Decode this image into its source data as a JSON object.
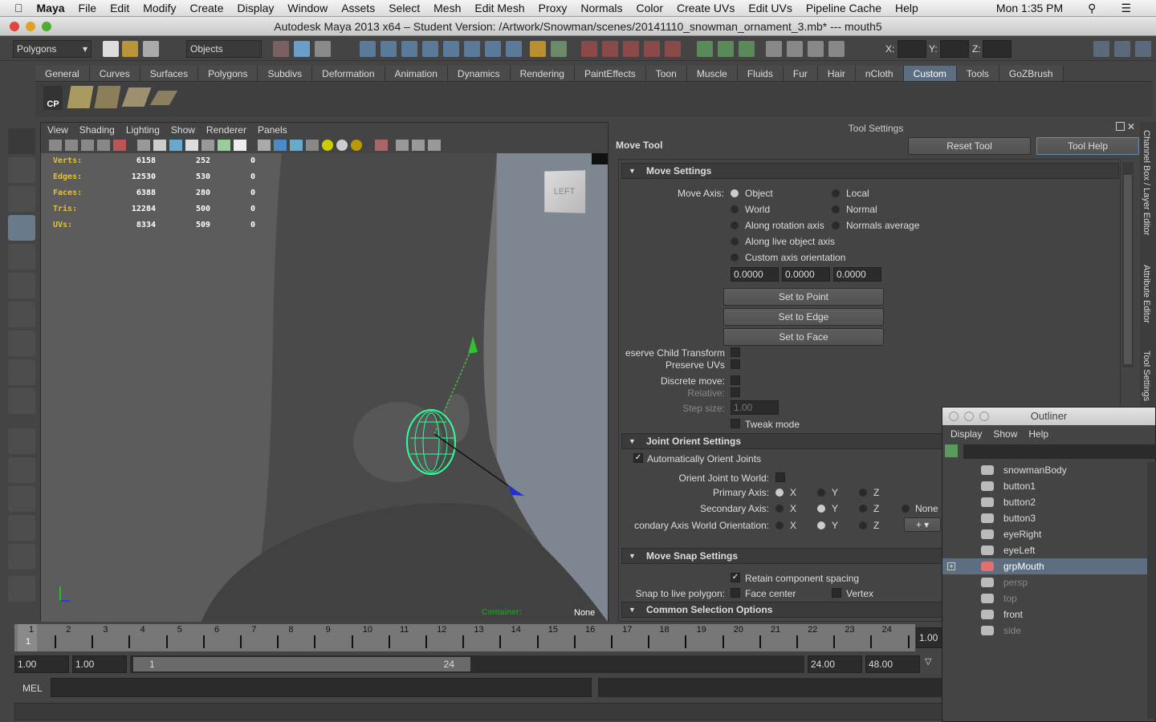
{
  "mac_menu": {
    "apple": "",
    "items": [
      "Maya",
      "File",
      "Edit",
      "Modify",
      "Create",
      "Display",
      "Window",
      "Assets",
      "Select",
      "Mesh",
      "Edit Mesh",
      "Proxy",
      "Normals",
      "Color",
      "Create UVs",
      "Edit UVs",
      "Pipeline Cache",
      "Help"
    ],
    "clock": "Mon 1:35 PM"
  },
  "window": {
    "title": "Autodesk Maya 2013 x64 – Student Version: /Artwork/Snowman/scenes/20141110_snowman_ornament_3.mb*  ---   mouth5"
  },
  "toolbar": {
    "menu_set": "Polygons",
    "selection_mode": "Objects",
    "x_label": "X:",
    "y_label": "Y:",
    "z_label": "Z:"
  },
  "shelf": {
    "tabs": [
      "General",
      "Curves",
      "Surfaces",
      "Polygons",
      "Subdivs",
      "Deformation",
      "Animation",
      "Dynamics",
      "Rendering",
      "PaintEffects",
      "Toon",
      "Muscle",
      "Fluids",
      "Fur",
      "Hair",
      "nCloth",
      "Custom",
      "Tools",
      "GoZBrush"
    ],
    "active": "Custom",
    "cp_label": "CP"
  },
  "viewport": {
    "menu": [
      "View",
      "Shading",
      "Lighting",
      "Show",
      "Renderer",
      "Panels"
    ],
    "hud": [
      {
        "label": "Verts:",
        "values": [
          "6158",
          "252",
          "0"
        ]
      },
      {
        "label": "Edges:",
        "values": [
          "12530",
          "530",
          "0"
        ]
      },
      {
        "label": "Faces:",
        "values": [
          "6388",
          "280",
          "0"
        ]
      },
      {
        "label": "Tris:",
        "values": [
          "12284",
          "500",
          "0"
        ]
      },
      {
        "label": "UVs:",
        "values": [
          "8334",
          "509",
          "0"
        ]
      }
    ],
    "view_cube": "LEFT",
    "container_label": "Container:",
    "container_value": "None"
  },
  "tool_settings": {
    "panel_title": "Tool Settings",
    "tool_name": "Move Tool",
    "reset": "Reset Tool",
    "help": "Tool Help",
    "move_settings": {
      "header": "Move Settings",
      "axis_label": "Move Axis:",
      "axis_options": [
        "Object",
        "Local",
        "World",
        "Normal",
        "Along rotation axis",
        "Normals average",
        "Along live object axis",
        "Custom axis orientation"
      ],
      "selected": "Object",
      "custom_values": [
        "0.0000",
        "0.0000",
        "0.0000"
      ],
      "set_point": "Set to Point",
      "set_edge": "Set to Edge",
      "set_face": "Set to Face",
      "preserve_child": "eserve Child Transform",
      "preserve_uvs": "Preserve UVs",
      "discrete": "Discrete move:",
      "relative": "Relative:",
      "step_label": "Step size:",
      "step_value": "1.00",
      "tweak": "Tweak mode"
    },
    "joint_orient": {
      "header": "Joint Orient Settings",
      "auto": "Automatically Orient Joints",
      "auto_checked": true,
      "orient_world": "Orient Joint to World:",
      "primary": "Primary Axis:",
      "secondary": "Secondary Axis:",
      "secondary_world": "condary Axis World Orientation:",
      "axes": [
        "X",
        "Y",
        "Z"
      ],
      "none": "None",
      "primary_sel": "X",
      "secondary_sel": "Y",
      "world_sel": "Y",
      "plus": "+"
    },
    "move_snap": {
      "header": "Move Snap Settings",
      "retain": "Retain component spacing",
      "retain_checked": true,
      "snap_label": "Snap to live polygon:",
      "face_center": "Face center",
      "vertex": "Vertex"
    },
    "common_sel": {
      "header": "Common Selection Options"
    }
  },
  "side_tabs": [
    "Channel Box / Layer Editor",
    "Attribute Editor",
    "Tool Settings"
  ],
  "outliner": {
    "title": "Outliner",
    "menu": [
      "Display",
      "Show",
      "Help"
    ],
    "items": [
      {
        "name": "snowmanBody"
      },
      {
        "name": "button1"
      },
      {
        "name": "button2"
      },
      {
        "name": "button3"
      },
      {
        "name": "eyeRight"
      },
      {
        "name": "eyeLeft"
      },
      {
        "name": "grpMouth",
        "selected": true
      },
      {
        "name": "persp",
        "dim": true
      },
      {
        "name": "top",
        "dim": true
      },
      {
        "name": "front"
      },
      {
        "name": "side",
        "dim": true
      }
    ]
  },
  "timeline": {
    "ticks": [
      "1",
      "2",
      "3",
      "4",
      "5",
      "6",
      "7",
      "8",
      "9",
      "10",
      "11",
      "12",
      "13",
      "14",
      "15",
      "16",
      "17",
      "18",
      "19",
      "20",
      "21",
      "22",
      "23",
      "24"
    ],
    "current": "1",
    "current_field": "1.00"
  },
  "range": {
    "start": "1.00",
    "playback_start": "1.00",
    "slider_start": "1",
    "slider_end": "24",
    "playback_end": "24.00",
    "end": "48.00"
  },
  "command": {
    "label": "MEL"
  },
  "colors": {
    "accent": "#5d6e80",
    "hud": "#e0c040",
    "wireframe": "#30ff9a"
  }
}
